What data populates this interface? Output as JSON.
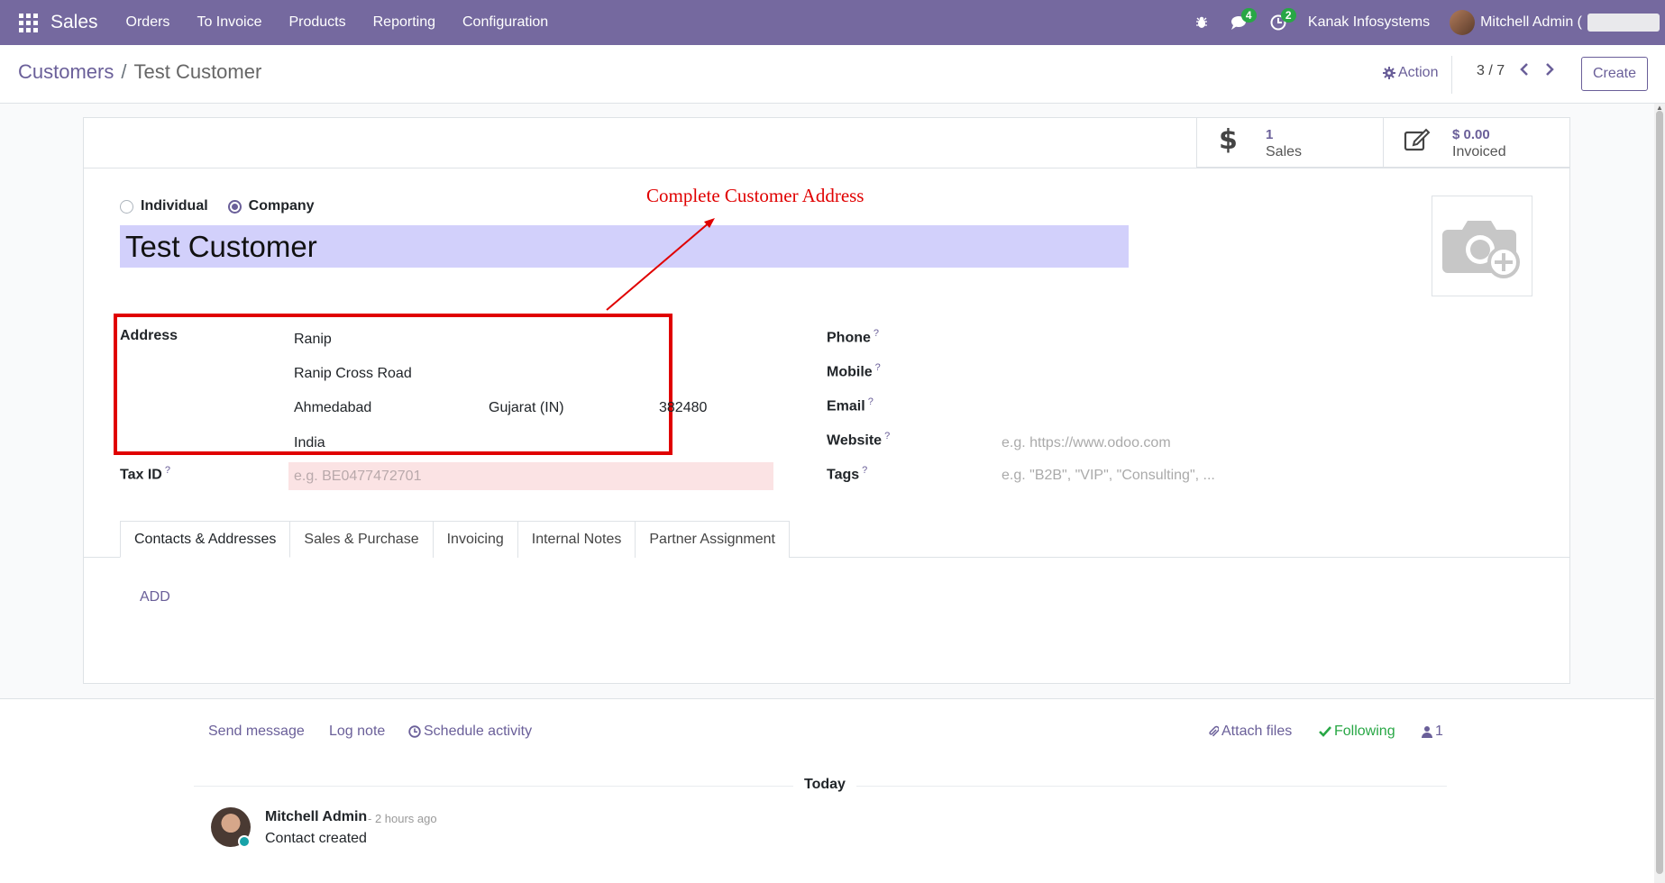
{
  "navbar": {
    "app_name": "Sales",
    "menu": [
      "Orders",
      "To Invoice",
      "Products",
      "Reporting",
      "Configuration"
    ],
    "messages_badge": "4",
    "activities_badge": "2",
    "company": "Kanak Infosystems",
    "user": "Mitchell Admin ("
  },
  "control_panel": {
    "breadcrumb_parent": "Customers",
    "breadcrumb_separator": "/",
    "breadcrumb_current": "Test Customer",
    "action_label": "Action",
    "pager": "3 / 7",
    "create_label": "Create"
  },
  "stat_buttons": {
    "sales_value": "1",
    "sales_label": "Sales",
    "invoiced_value": "$ 0.00",
    "invoiced_label": "Invoiced"
  },
  "form": {
    "type_individual": "Individual",
    "type_company": "Company",
    "selected_type": "Company",
    "name": "Test Customer",
    "annotation": "Complete Customer Address",
    "address_label": "Address",
    "street": "Ranip",
    "street2": "Ranip Cross Road",
    "city": "Ahmedabad",
    "state": "Gujarat (IN)",
    "zip": "382480",
    "country": "India",
    "taxid_label": "Tax ID",
    "taxid_placeholder": "e.g. BE0477472701",
    "phone_label": "Phone",
    "mobile_label": "Mobile",
    "email_label": "Email",
    "website_label": "Website",
    "website_placeholder": "e.g. https://www.odoo.com",
    "tags_label": "Tags",
    "tags_placeholder": "e.g. \"B2B\", \"VIP\", \"Consulting\", ...",
    "help_mark": "?"
  },
  "tabs": [
    "Contacts & Addresses",
    "Sales & Purchase",
    "Invoicing",
    "Internal Notes",
    "Partner Assignment"
  ],
  "active_tab": "Contacts & Addresses",
  "add_label": "ADD",
  "chatter": {
    "send_message": "Send message",
    "log_note": "Log note",
    "schedule_activity": "Schedule activity",
    "attach_files": "Attach files",
    "following": "Following",
    "followers_count": "1",
    "date_separator": "Today",
    "message": {
      "author": "Mitchell Admin",
      "time": "- 2 hours ago",
      "body": "Contact created"
    }
  },
  "colors": {
    "navbar": "#75699f",
    "accent": "#6a5f99",
    "annotation_red": "#e00000",
    "name_highlight": "#d2d0fb",
    "required_field": "#fbe3e4",
    "success": "#28a745"
  }
}
